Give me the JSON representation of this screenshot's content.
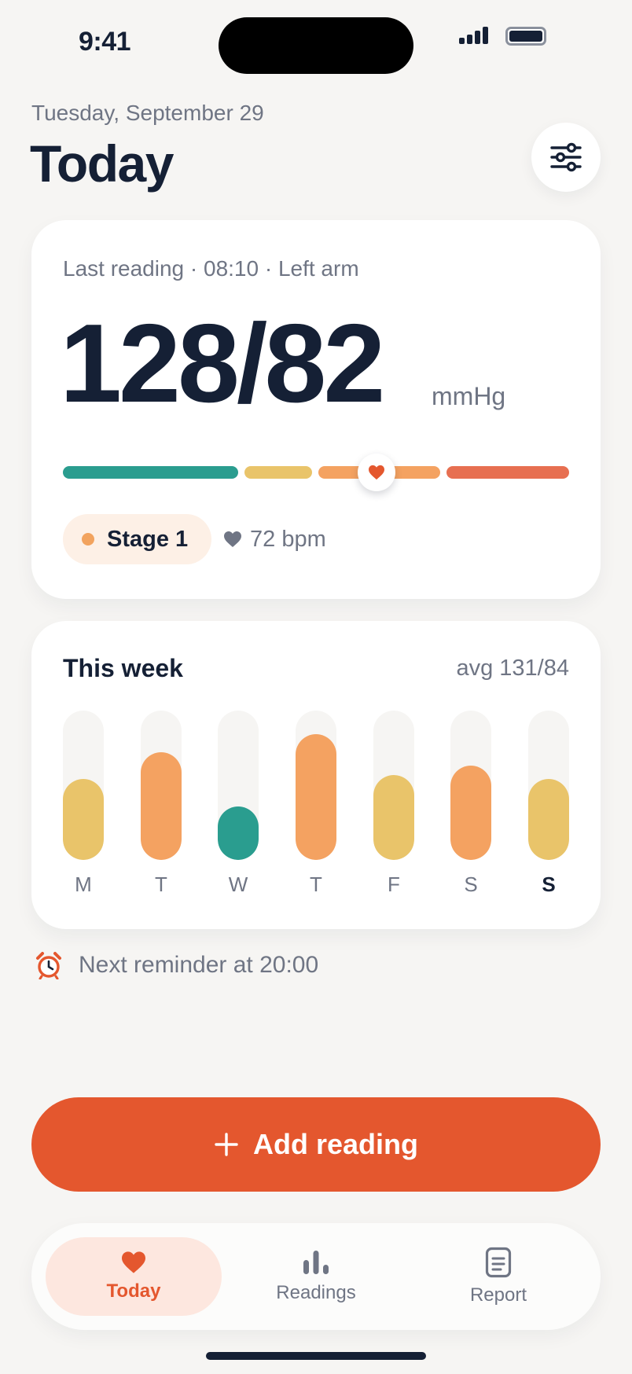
{
  "status_bar": {
    "time": "9:41"
  },
  "header": {
    "date": "Tuesday, September 29",
    "title": "Today",
    "filter_icon": "sliders-icon"
  },
  "reading": {
    "meta": "Last reading · 08:10 · Left arm",
    "value": "128/82",
    "unit": "mmHg",
    "scale": {
      "position": 0.62,
      "segments": [
        {
          "name": "normal",
          "color": "#2a9d8f"
        },
        {
          "name": "elevated",
          "color": "#e9c46a"
        },
        {
          "name": "stage1",
          "color": "#f4a261"
        },
        {
          "name": "stage2",
          "color": "#e76f51"
        }
      ]
    },
    "stage": {
      "label": "Stage 1",
      "color": "#f2a35e"
    },
    "pulse": "72 bpm"
  },
  "week": {
    "title": "This week",
    "avg": "avg 131/84",
    "days": [
      {
        "label": "M",
        "level": 0.54,
        "color": "#e9c46a",
        "today": false
      },
      {
        "label": "T",
        "level": 0.72,
        "color": "#f4a261",
        "today": false
      },
      {
        "label": "W",
        "level": 0.36,
        "color": "#2a9d8f",
        "today": false
      },
      {
        "label": "T",
        "level": 0.84,
        "color": "#f4a261",
        "today": false
      },
      {
        "label": "F",
        "level": 0.57,
        "color": "#e9c46a",
        "today": false
      },
      {
        "label": "S",
        "level": 0.63,
        "color": "#f4a261",
        "today": false
      },
      {
        "label": "S",
        "level": 0.54,
        "color": "#e9c46a",
        "today": true
      }
    ]
  },
  "reminder": {
    "label": "Next reminder at 20:00",
    "icon": "alarm-clock-icon"
  },
  "actions": {
    "add_label": "Add reading",
    "add_icon": "plus-icon"
  },
  "tabs": [
    {
      "label": "Today",
      "icon": "heart-icon",
      "active": true
    },
    {
      "label": "Readings",
      "icon": "bar-chart-icon",
      "active": false
    },
    {
      "label": "Report",
      "icon": "document-icon",
      "active": false
    }
  ],
  "colors": {
    "accent": "#e4572e",
    "ink": "#152035",
    "muted": "#6f7584"
  }
}
